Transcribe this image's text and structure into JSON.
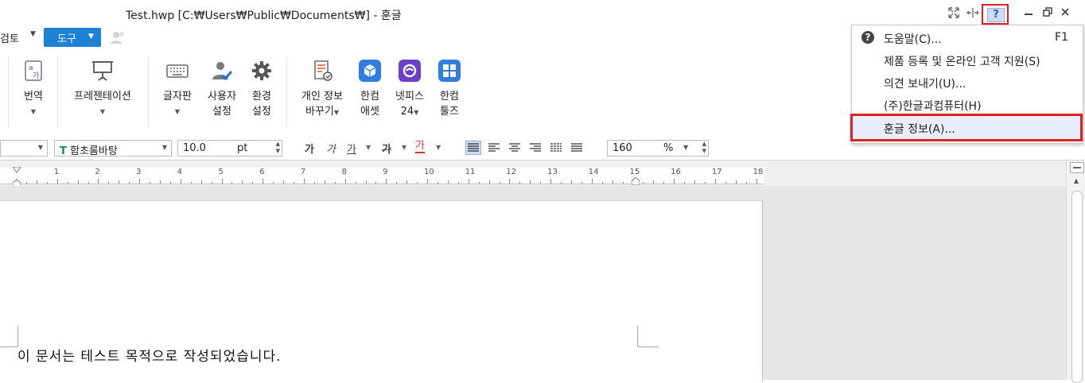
{
  "window": {
    "title": "Test.hwp [C:₩Users₩Public₩Documents₩] - 훈글"
  },
  "menu_tabs": {
    "review": "검토",
    "tools": "도구"
  },
  "ribbon": {
    "translate": "번역",
    "presentation": "프레젠테이션",
    "keyboard": "글자판",
    "user_settings_1": "사용자",
    "user_settings_2": "설정",
    "env_settings_1": "환경",
    "env_settings_2": "설정",
    "privacy_1": "개인 정보",
    "privacy_2": "바꾸기",
    "hancom_asset_1": "한컴",
    "hancom_asset_2": "애셋",
    "netffice_1": "넷피스",
    "netffice_2": "24",
    "hancom_tools_1": "한컴",
    "hancom_tools_2": "툴즈"
  },
  "format_toolbar": {
    "font_name": "함초롬바탕",
    "font_size": "10.0",
    "font_unit": "pt",
    "zoom": "160",
    "zoom_unit": "%",
    "bold_glyph": "가",
    "italic_glyph": "가",
    "underline_glyph": "가",
    "strike_glyph": "가",
    "color_glyph": "가"
  },
  "ruler": {
    "ticks": [
      "1",
      "2",
      "3",
      "4",
      "5",
      "6",
      "7",
      "8",
      "9",
      "10",
      "11",
      "12",
      "13",
      "14",
      "15",
      "16",
      "17",
      "18"
    ]
  },
  "document": {
    "body_text": "이 문서는 테스트 목적으로 작성되었습니다."
  },
  "help_menu": {
    "items": [
      {
        "label": "도움말(C)...",
        "shortcut": "F1"
      },
      {
        "label": "제품 등록 및 온라인 고객 지원(S)"
      },
      {
        "label": "의견 보내기(U)..."
      },
      {
        "label": "(주)한글과컴퓨터(H)"
      },
      {
        "label": "훈글 정보(A)..."
      }
    ]
  },
  "colors": {
    "accent": "#1d82d6",
    "highlight": "#e02020",
    "menu_hover": "#e8eefb"
  }
}
